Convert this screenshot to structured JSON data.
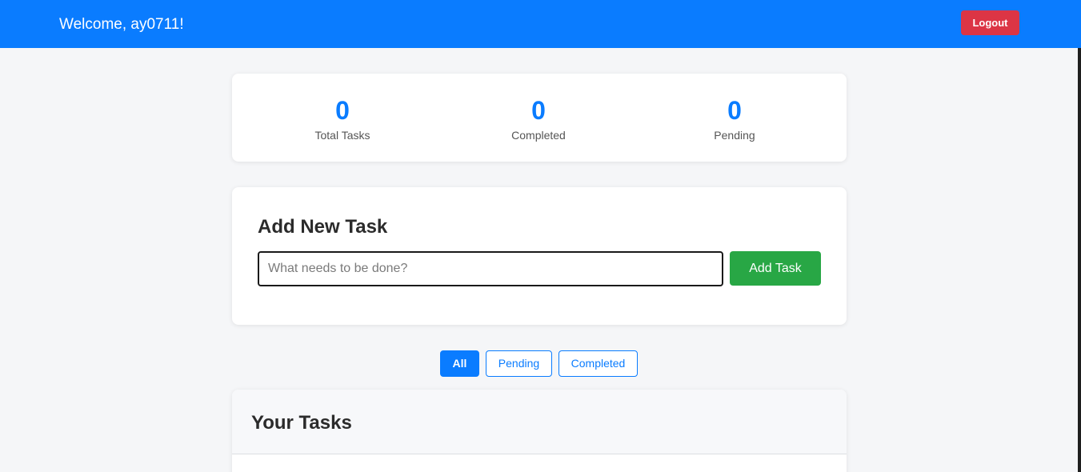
{
  "header": {
    "welcome_text": "Welcome, ay0711!",
    "logout_label": "Logout"
  },
  "stats": {
    "total": {
      "value": "0",
      "label": "Total Tasks"
    },
    "completed": {
      "value": "0",
      "label": "Completed"
    },
    "pending": {
      "value": "0",
      "label": "Pending"
    }
  },
  "add_task": {
    "title": "Add New Task",
    "input_value": "",
    "input_placeholder": "What needs to be done?",
    "button_label": "Add Task"
  },
  "filters": {
    "selected": "All",
    "items": [
      {
        "label": "All"
      },
      {
        "label": "Pending"
      },
      {
        "label": "Completed"
      }
    ]
  },
  "tasks": {
    "title": "Your Tasks",
    "items": []
  },
  "colors": {
    "primary": "#0a7cff",
    "danger": "#dc3545",
    "success": "#28a745",
    "background": "#f5f6f8"
  }
}
